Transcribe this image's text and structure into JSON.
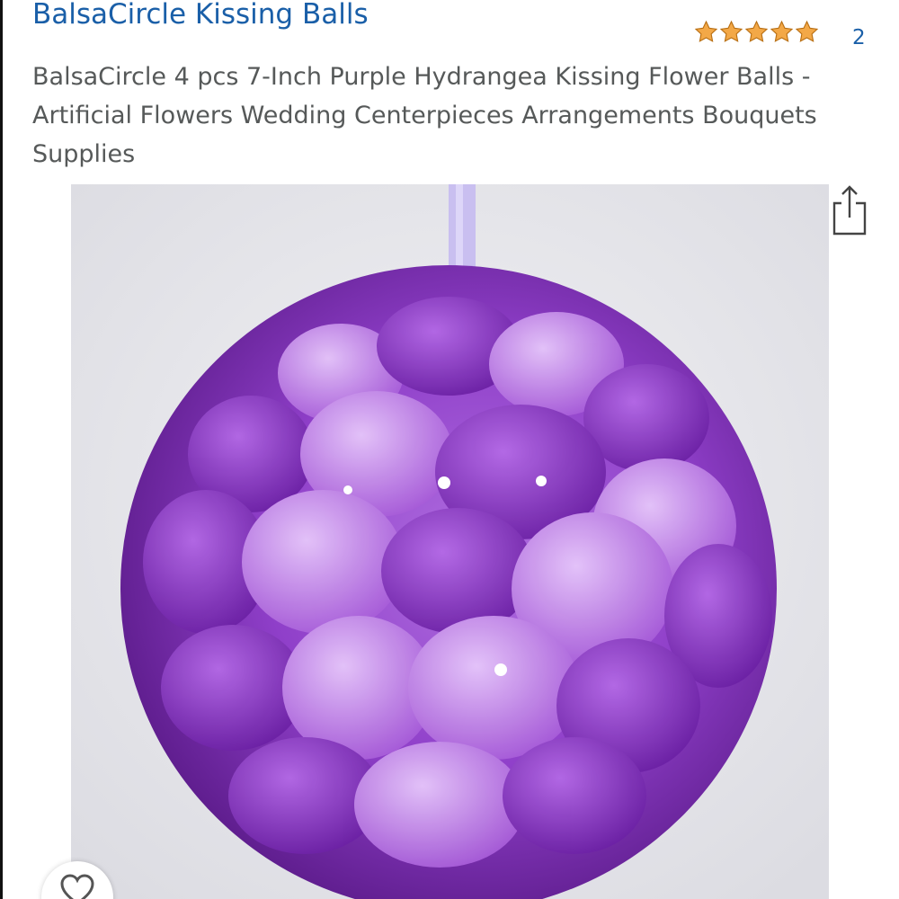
{
  "brand": {
    "name": "BalsaCircle Kissing Balls"
  },
  "rating": {
    "stars": 5,
    "max_stars": 5,
    "review_count": "2",
    "star_color": "#f3a847"
  },
  "product": {
    "title": "BalsaCircle 4 pcs 7-Inch Purple Hydrangea Kissing Flower Balls - Artificial Flowers Wedding Centerpieces Arrangements Bouquets Supplies",
    "image_icon": "purple-hydrangea-kissing-ball-photo"
  },
  "actions": {
    "share_icon": "share-icon",
    "wishlist_icon": "heart-icon"
  },
  "colors": {
    "link": "#1a5fa8",
    "title_text": "#565959",
    "image_background": "#e6e6ea"
  }
}
